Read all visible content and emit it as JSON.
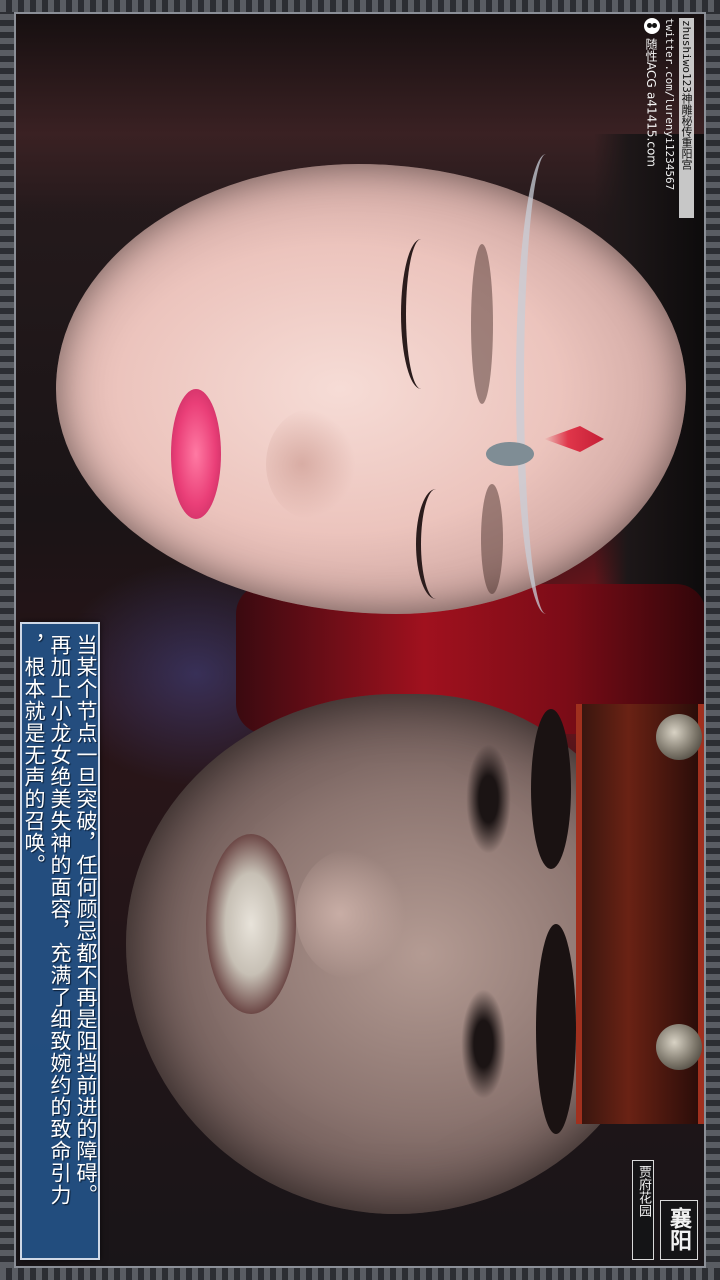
{
  "watermark": {
    "site_line": "zhushiwo123神雕秘传重阳宫",
    "twitter_line": "twitter.com/lurenyi1234567",
    "brand_line": "随性ACG",
    "domain_line": "a41415.com"
  },
  "caption": {
    "lines": [
      "当某个节点一旦突破，任何顾忌都不再是阻挡前进的障碍。",
      "再加上小龙女绝美失神的面容，充满了细致婉约的致命引力",
      "，根本就是无声的召唤。"
    ]
  },
  "location": {
    "main": "襄阳",
    "sub": "贾府花园"
  }
}
